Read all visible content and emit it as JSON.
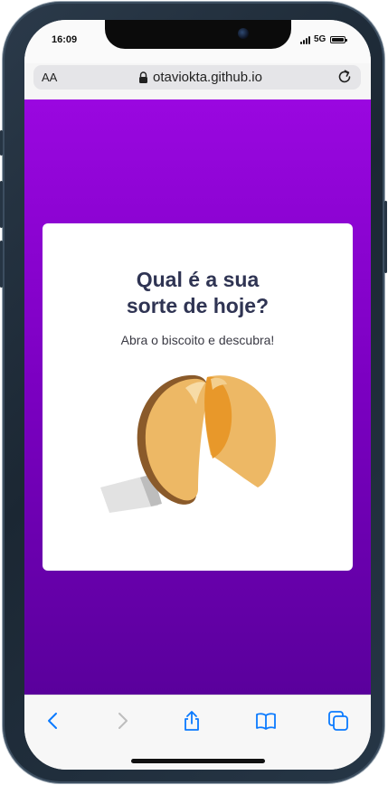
{
  "status": {
    "time": "16:09",
    "network": "5G"
  },
  "browser": {
    "text_size_label": "AA",
    "url": "otaviokta.github.io"
  },
  "card": {
    "title_line1": "Qual é a sua",
    "title_line2": "sorte de hoje?",
    "subtitle": "Abra o biscoito e descubra!"
  },
  "toolbar": {
    "icons": [
      "back-icon",
      "forward-icon",
      "share-icon",
      "bookmarks-icon",
      "tabs-icon"
    ]
  },
  "colors": {
    "gradient_top": "#9a07e0",
    "gradient_bottom": "#5a009c",
    "title": "#2f3453",
    "ios_blue": "#0a7aff"
  }
}
